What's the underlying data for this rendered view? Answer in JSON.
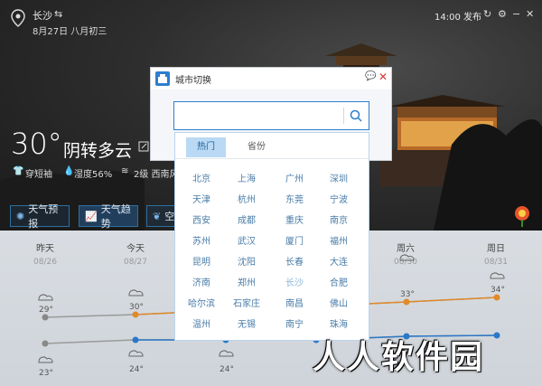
{
  "topbar": {
    "city": "长沙",
    "date": "8月27日 八月初三",
    "publish": "14:00 发布"
  },
  "current": {
    "temp": "30°",
    "desc": "阴转多云",
    "clothing": "穿短袖",
    "humidity": "湿度56%",
    "wind": "2级 西南风"
  },
  "tabs": [
    {
      "label": "天气预报"
    },
    {
      "label": "天气趋势"
    },
    {
      "label": "空"
    }
  ],
  "forecast": [
    {
      "name": "昨天",
      "date": "08/26",
      "high": "29°",
      "low": "23°"
    },
    {
      "name": "今天",
      "date": "08/27",
      "high": "30°",
      "low": "24°"
    },
    {
      "name": "",
      "date": "",
      "high": "",
      "low": "24°"
    },
    {
      "name": "周六",
      "date": "08/30",
      "high": "33°",
      "low": ""
    },
    {
      "name": "周日",
      "date": "08/31",
      "high": "34°",
      "low": ""
    }
  ],
  "popup": {
    "title": "城市切换",
    "search_value": "",
    "tab_hot": "热门",
    "tab_province": "省份",
    "cities": [
      [
        "北京",
        "上海",
        "广州",
        "深圳"
      ],
      [
        "天津",
        "杭州",
        "东莞",
        "宁波"
      ],
      [
        "西安",
        "成都",
        "重庆",
        "南京"
      ],
      [
        "苏州",
        "武汉",
        "厦门",
        "福州"
      ],
      [
        "昆明",
        "沈阳",
        "长春",
        "大连"
      ],
      [
        "济南",
        "郑州",
        "长沙",
        "合肥"
      ],
      [
        "哈尔滨",
        "石家庄",
        "南昌",
        "佛山"
      ],
      [
        "温州",
        "无锡",
        "南宁",
        "珠海"
      ]
    ],
    "selected_city": "长沙"
  },
  "watermark": "人人软件园",
  "colors": {
    "accent": "#2c7dd0",
    "high_line": "#e08a2a",
    "low_line": "#2a78c8"
  }
}
